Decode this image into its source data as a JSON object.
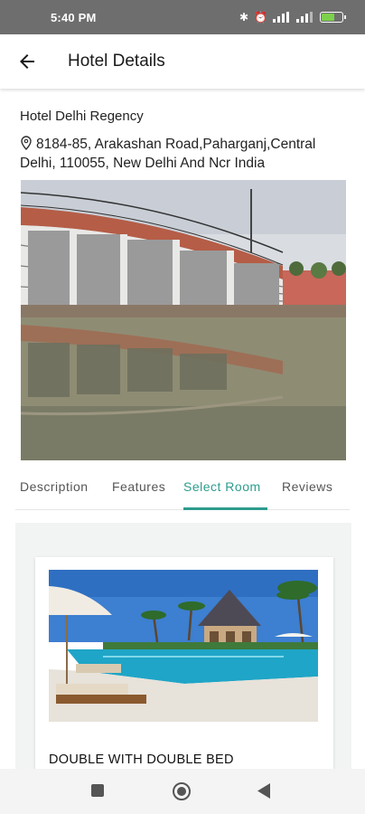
{
  "status_bar": {
    "time": "5:40 PM",
    "battery_level": 0.6
  },
  "app_bar": {
    "title": "Hotel Details",
    "back_icon": "arrow-left-icon"
  },
  "hotel": {
    "name": "Hotel Delhi Regency",
    "address": "8184-85, Arakashan Road,Paharganj,Central Delhi, 110055, New Delhi And Ncr India"
  },
  "tabs": [
    {
      "label": "Description",
      "active": false
    },
    {
      "label": "Features",
      "active": false
    },
    {
      "label": "Select Room",
      "active": true
    },
    {
      "label": "Reviews",
      "active": false
    }
  ],
  "room": {
    "name": "DOUBLE WITH DOUBLE BED"
  },
  "colors": {
    "accent": "#2e9c8e",
    "status_bar": "#6e6e6e"
  }
}
